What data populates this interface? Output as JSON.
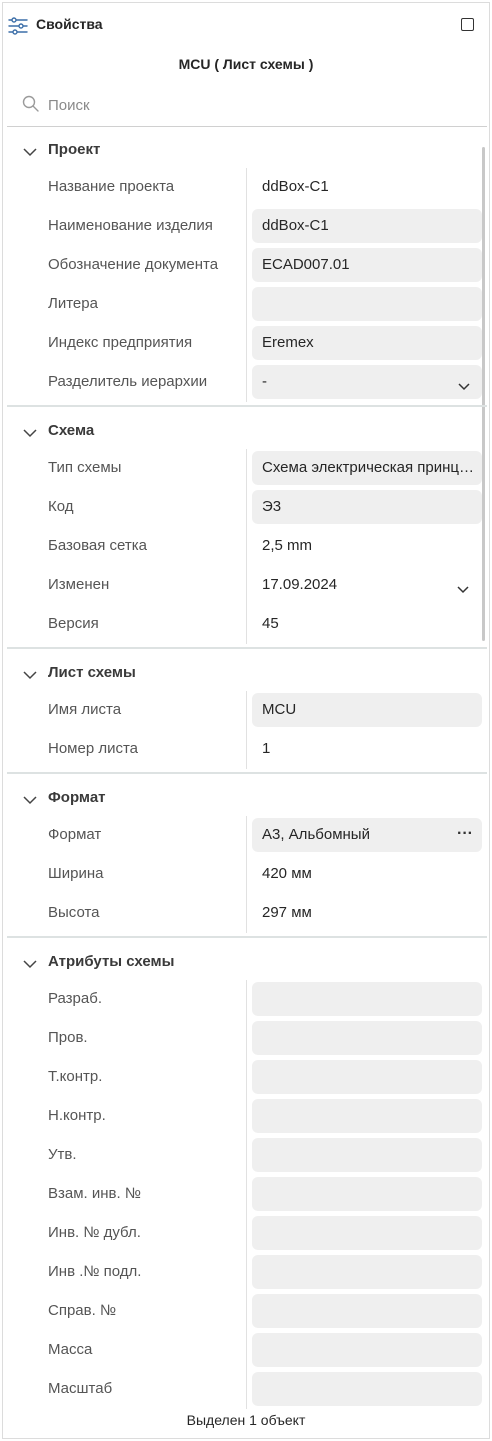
{
  "panel": {
    "title": "Свойства",
    "icons": {
      "header": "sliders-icon",
      "maximize": "maximize-icon",
      "search": "search-icon",
      "collapse": "chevron-down-icon",
      "more": "more-dots-icon"
    },
    "subtitle": "MCU ( Лист схемы )"
  },
  "search": {
    "placeholder": "Поиск",
    "value": ""
  },
  "sections": {
    "project": {
      "title": "Проект",
      "rows": [
        {
          "label": "Название проекта",
          "value": "ddBox-C1"
        },
        {
          "label": "Наименование изделия",
          "value": "ddBox-C1"
        },
        {
          "label": "Обозначение документа",
          "value": "ECAD007.01"
        },
        {
          "label": "Литера",
          "value": ""
        },
        {
          "label": "Индекс предприятия",
          "value": "Eremex"
        },
        {
          "label": "Разделитель иерархии",
          "value": "-"
        }
      ]
    },
    "scheme": {
      "title": "Схема",
      "rows": [
        {
          "label": "Тип схемы",
          "value": "Схема электрическая принципиальная"
        },
        {
          "label": "Код",
          "value": "Э3"
        },
        {
          "label": "Базовая сетка",
          "value": "2,5 mm"
        },
        {
          "label": "Изменен",
          "value": "17.09.2024"
        },
        {
          "label": "Версия",
          "value": "45"
        }
      ]
    },
    "sheet": {
      "title": "Лист схемы",
      "rows": [
        {
          "label": "Имя листа",
          "value": "MCU"
        },
        {
          "label": "Номер листа",
          "value": "1"
        }
      ]
    },
    "format": {
      "title": "Формат",
      "rows": [
        {
          "label": "Формат",
          "value": "А3, Альбомный"
        },
        {
          "label": "Ширина",
          "value": "420 мм"
        },
        {
          "label": "Высота",
          "value": "297 мм"
        }
      ]
    },
    "attributes": {
      "title": "Атрибуты схемы",
      "rows": [
        {
          "label": "Разраб.",
          "value": ""
        },
        {
          "label": "Пров.",
          "value": ""
        },
        {
          "label": "Т.контр.",
          "value": ""
        },
        {
          "label": "Н.контр.",
          "value": ""
        },
        {
          "label": "Утв.",
          "value": ""
        },
        {
          "label": "Взам. инв. №",
          "value": ""
        },
        {
          "label": "Инв. № дубл.",
          "value": ""
        },
        {
          "label": "Инв .№ подл.",
          "value": ""
        },
        {
          "label": "Справ. №",
          "value": ""
        },
        {
          "label": "Масса",
          "value": ""
        },
        {
          "label": "Масштаб",
          "value": ""
        }
      ]
    }
  },
  "status": "Выделен 1 объект",
  "colors": {
    "field_bg": "#efefef",
    "divider": "#dde2e2",
    "text": "#262626"
  }
}
